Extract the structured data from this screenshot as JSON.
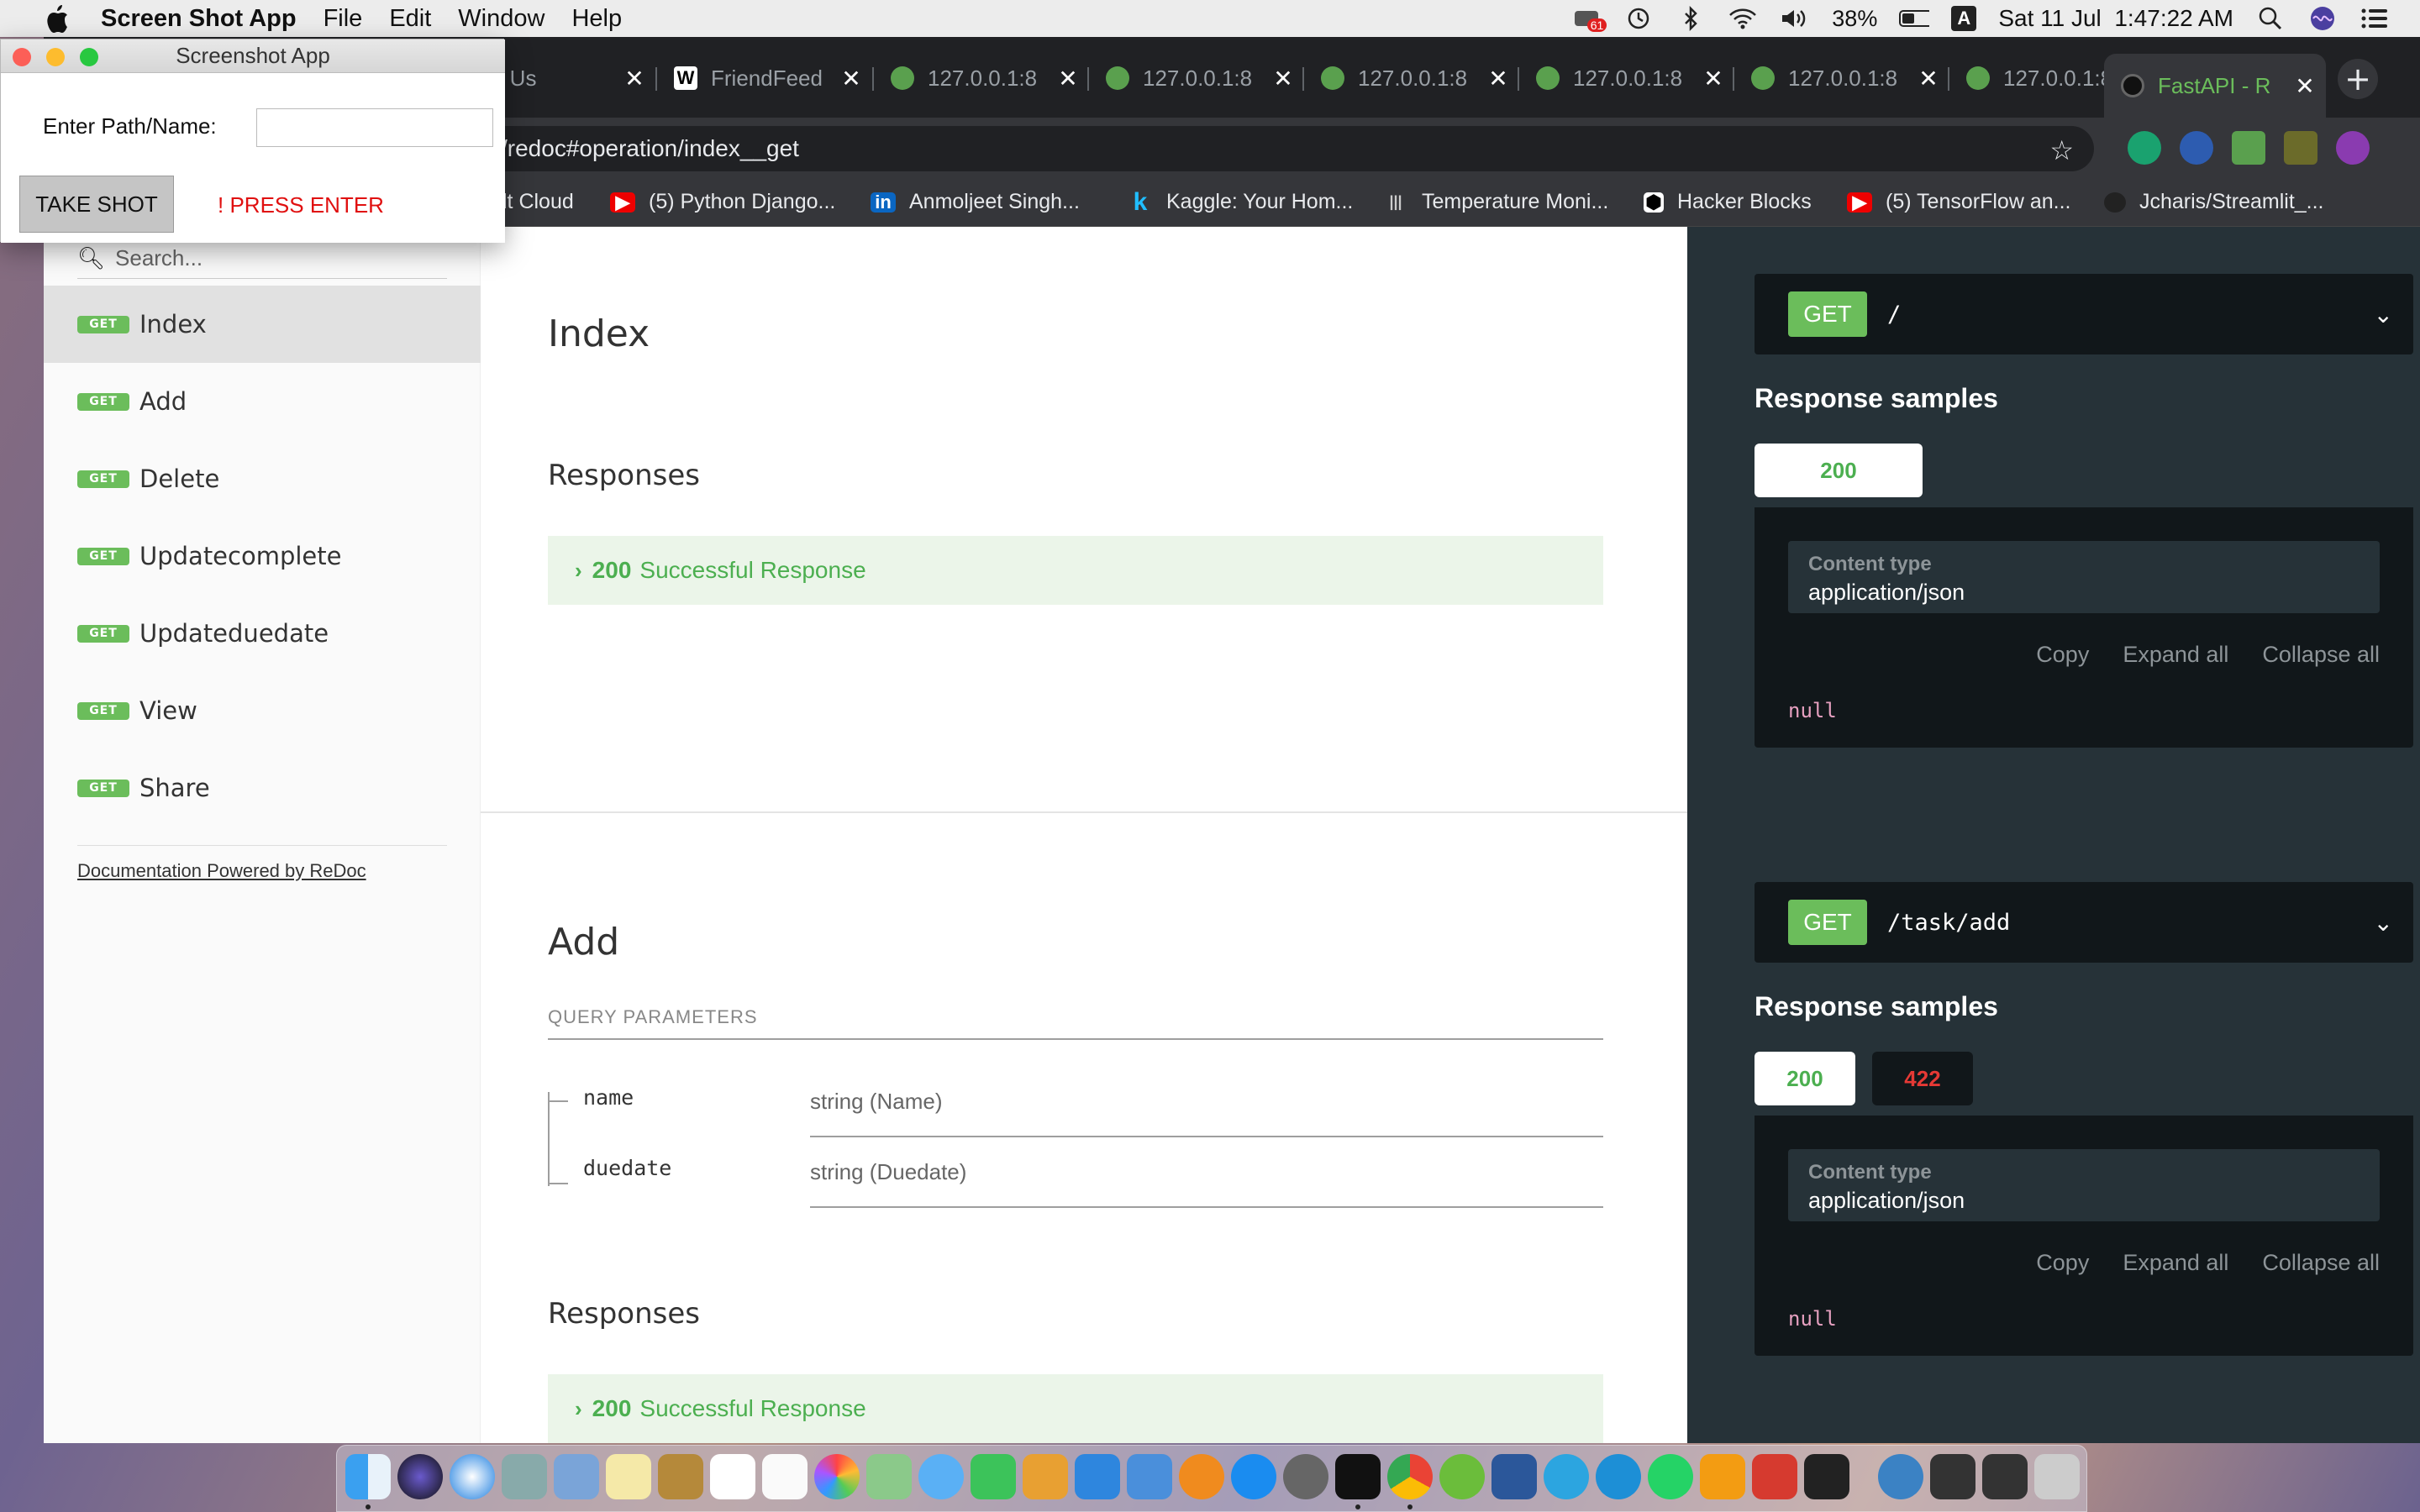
{
  "menubar": {
    "app_name": "Screen Shot App",
    "items": [
      "File",
      "Edit",
      "Window",
      "Help"
    ],
    "badge": "61",
    "battery": "38%",
    "input_source": "A",
    "datetime": "Sat 11 Jul  1:47:22 AM"
  },
  "browser": {
    "tabs": [
      {
        "title": "al: Us"
      },
      {
        "title": "FriendFeed"
      },
      {
        "title": "127.0.0.1:8"
      },
      {
        "title": "127.0.0.1:8"
      },
      {
        "title": "127.0.0.1:8"
      },
      {
        "title": "127.0.0.1:8"
      },
      {
        "title": "127.0.0.1:8"
      },
      {
        "title": "127.0.0.1:8"
      },
      {
        "title": "FastAPI - R"
      }
    ],
    "url": "/redoc#operation/index__get",
    "bookmarks": [
      "lt Cloud",
      "(5) Python Django...",
      "Anmoljeet Singh...",
      "Kaggle: Your Hom...",
      "Temperature Moni...",
      "Hacker Blocks",
      "(5) TensorFlow an...",
      "Jcharis/Streamlit_..."
    ]
  },
  "screenshot_app": {
    "title": "Screenshot App",
    "label": "Enter Path/Name:",
    "input_value": "",
    "button": "TAKE SHOT",
    "hint": "! PRESS ENTER"
  },
  "sidebar": {
    "search_placeholder": "Search...",
    "badge": "GET",
    "items": [
      "Index",
      "Add",
      "Delete",
      "Updatecomplete",
      "Updateduedate",
      "View",
      "Share"
    ],
    "powered_by": "Documentation Powered by ReDoc"
  },
  "main": {
    "index": {
      "title": "Index",
      "responses_heading": "Responses",
      "response_code": "200",
      "response_text": "Successful Response"
    },
    "add": {
      "title": "Add",
      "query_params_label": "QUERY PARAMETERS",
      "params": [
        {
          "name": "name",
          "type": "string (Name)"
        },
        {
          "name": "duedate",
          "type": "string (Duedate)"
        }
      ],
      "responses_heading": "Responses",
      "response_code": "200",
      "response_text": "Successful Response"
    }
  },
  "right_panel": {
    "ops": [
      {
        "method": "GET",
        "path": "/",
        "samples_heading": "Response samples",
        "tabs": [
          "200"
        ],
        "content_type_label": "Content type",
        "content_type": "application/json",
        "actions": [
          "Copy",
          "Expand all",
          "Collapse all"
        ],
        "body": "null"
      },
      {
        "method": "GET",
        "path": "/task/add",
        "samples_heading": "Response samples",
        "tabs": [
          "200",
          "422"
        ],
        "content_type_label": "Content type",
        "content_type": "application/json",
        "actions": [
          "Copy",
          "Expand all",
          "Collapse all"
        ],
        "body": "null"
      }
    ]
  },
  "colors": {
    "get_green": "#6bbd5b",
    "success_text": "#4caf50",
    "error_red": "#e53935",
    "panel_dark": "#263238"
  }
}
